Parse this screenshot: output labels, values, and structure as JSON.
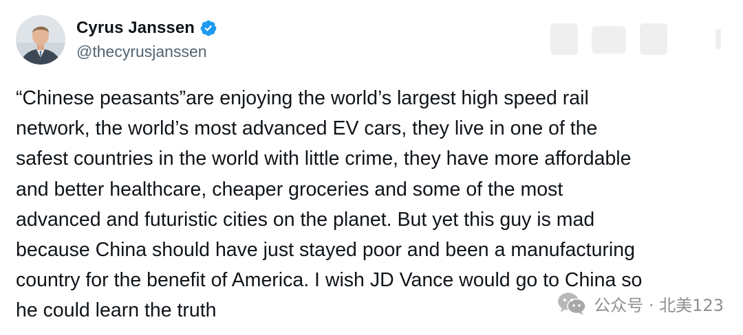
{
  "author": {
    "display_name": "Cyrus Janssen",
    "handle": "@thecyrusjanssen",
    "verified": true,
    "verified_color": "#1d9bf0"
  },
  "tweet": {
    "lines": [
      "“Chinese peasants”are enjoying the world’s largest high speed rail",
      "network, the world’s most advanced EV cars, they live in one of the",
      "safest countries in the world with little crime, they have more affordable",
      "and better healthcare, cheaper groceries and some of the most",
      "advanced and futuristic cities on the planet. But yet this guy is mad",
      "because China should have just stayed poor and been a manufacturing",
      "country for the benefit of America. I wish JD Vance would go to China so",
      "he could learn the truth"
    ]
  },
  "watermark": {
    "icon": "wechat-icon",
    "text": "公众号 · 北美123"
  }
}
